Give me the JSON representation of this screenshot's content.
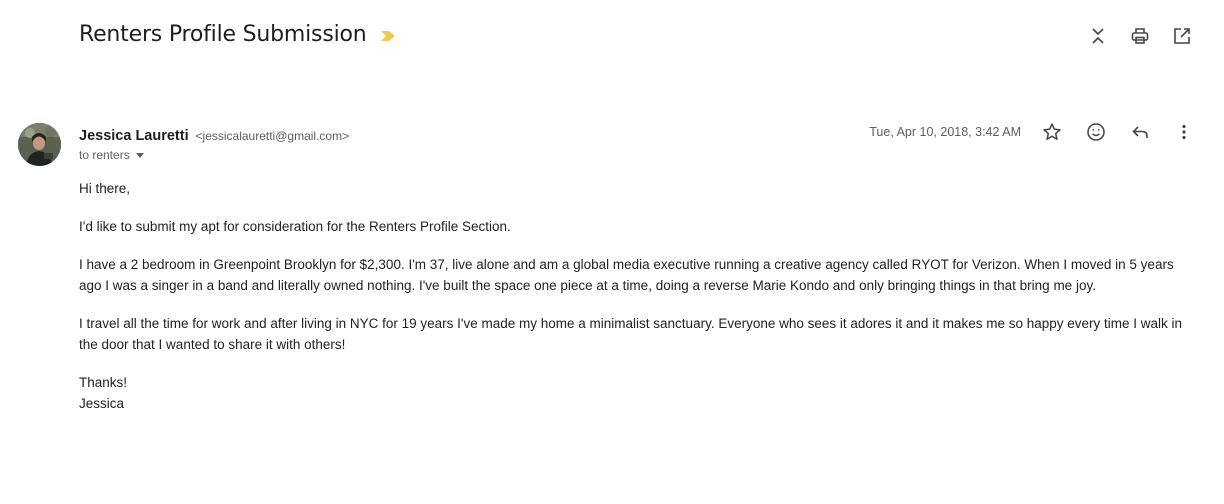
{
  "email": {
    "subject": "Renters Profile Submission",
    "sender": {
      "name": "Jessica Lauretti",
      "email": "<jessicalauretti@gmail.com>"
    },
    "recipient_text": "to renters",
    "date": "Tue, Apr 10, 2018, 3:42 AM",
    "body": {
      "greeting": "Hi there,",
      "p1": "I'd like to submit my apt for consideration for the Renters Profile Section.",
      "p2": "I have a 2 bedroom in Greenpoint Brooklyn for $2,300.  I'm 37, live alone and am a global media executive running a creative agency called RYOT for Verizon.  When I moved in 5 years ago I was a singer in a band and literally owned nothing.  I've built the space one piece at a time, doing a reverse Marie Kondo and only bringing things in that bring me joy.",
      "p3": "I travel all the time for work and after living in NYC for 19 years I've made my home a minimalist sanctuary.  Everyone who sees it adores it and it makes me so happy every time I walk in the door that I wanted to share it with others!",
      "closing": "Thanks!",
      "signature": "Jessica"
    }
  },
  "icons": {
    "importance": "importance-marker-icon",
    "collapse": "collapse-all-icon",
    "print": "print-icon",
    "new_window": "open-in-new-window-icon",
    "star": "star-icon",
    "emoji": "emoji-reaction-icon",
    "reply": "reply-icon",
    "more": "more-options-icon"
  },
  "colors": {
    "importance": "#f2c94c",
    "icon": "#444746",
    "text": "#202124",
    "secondary_text": "#5e5e5e"
  }
}
